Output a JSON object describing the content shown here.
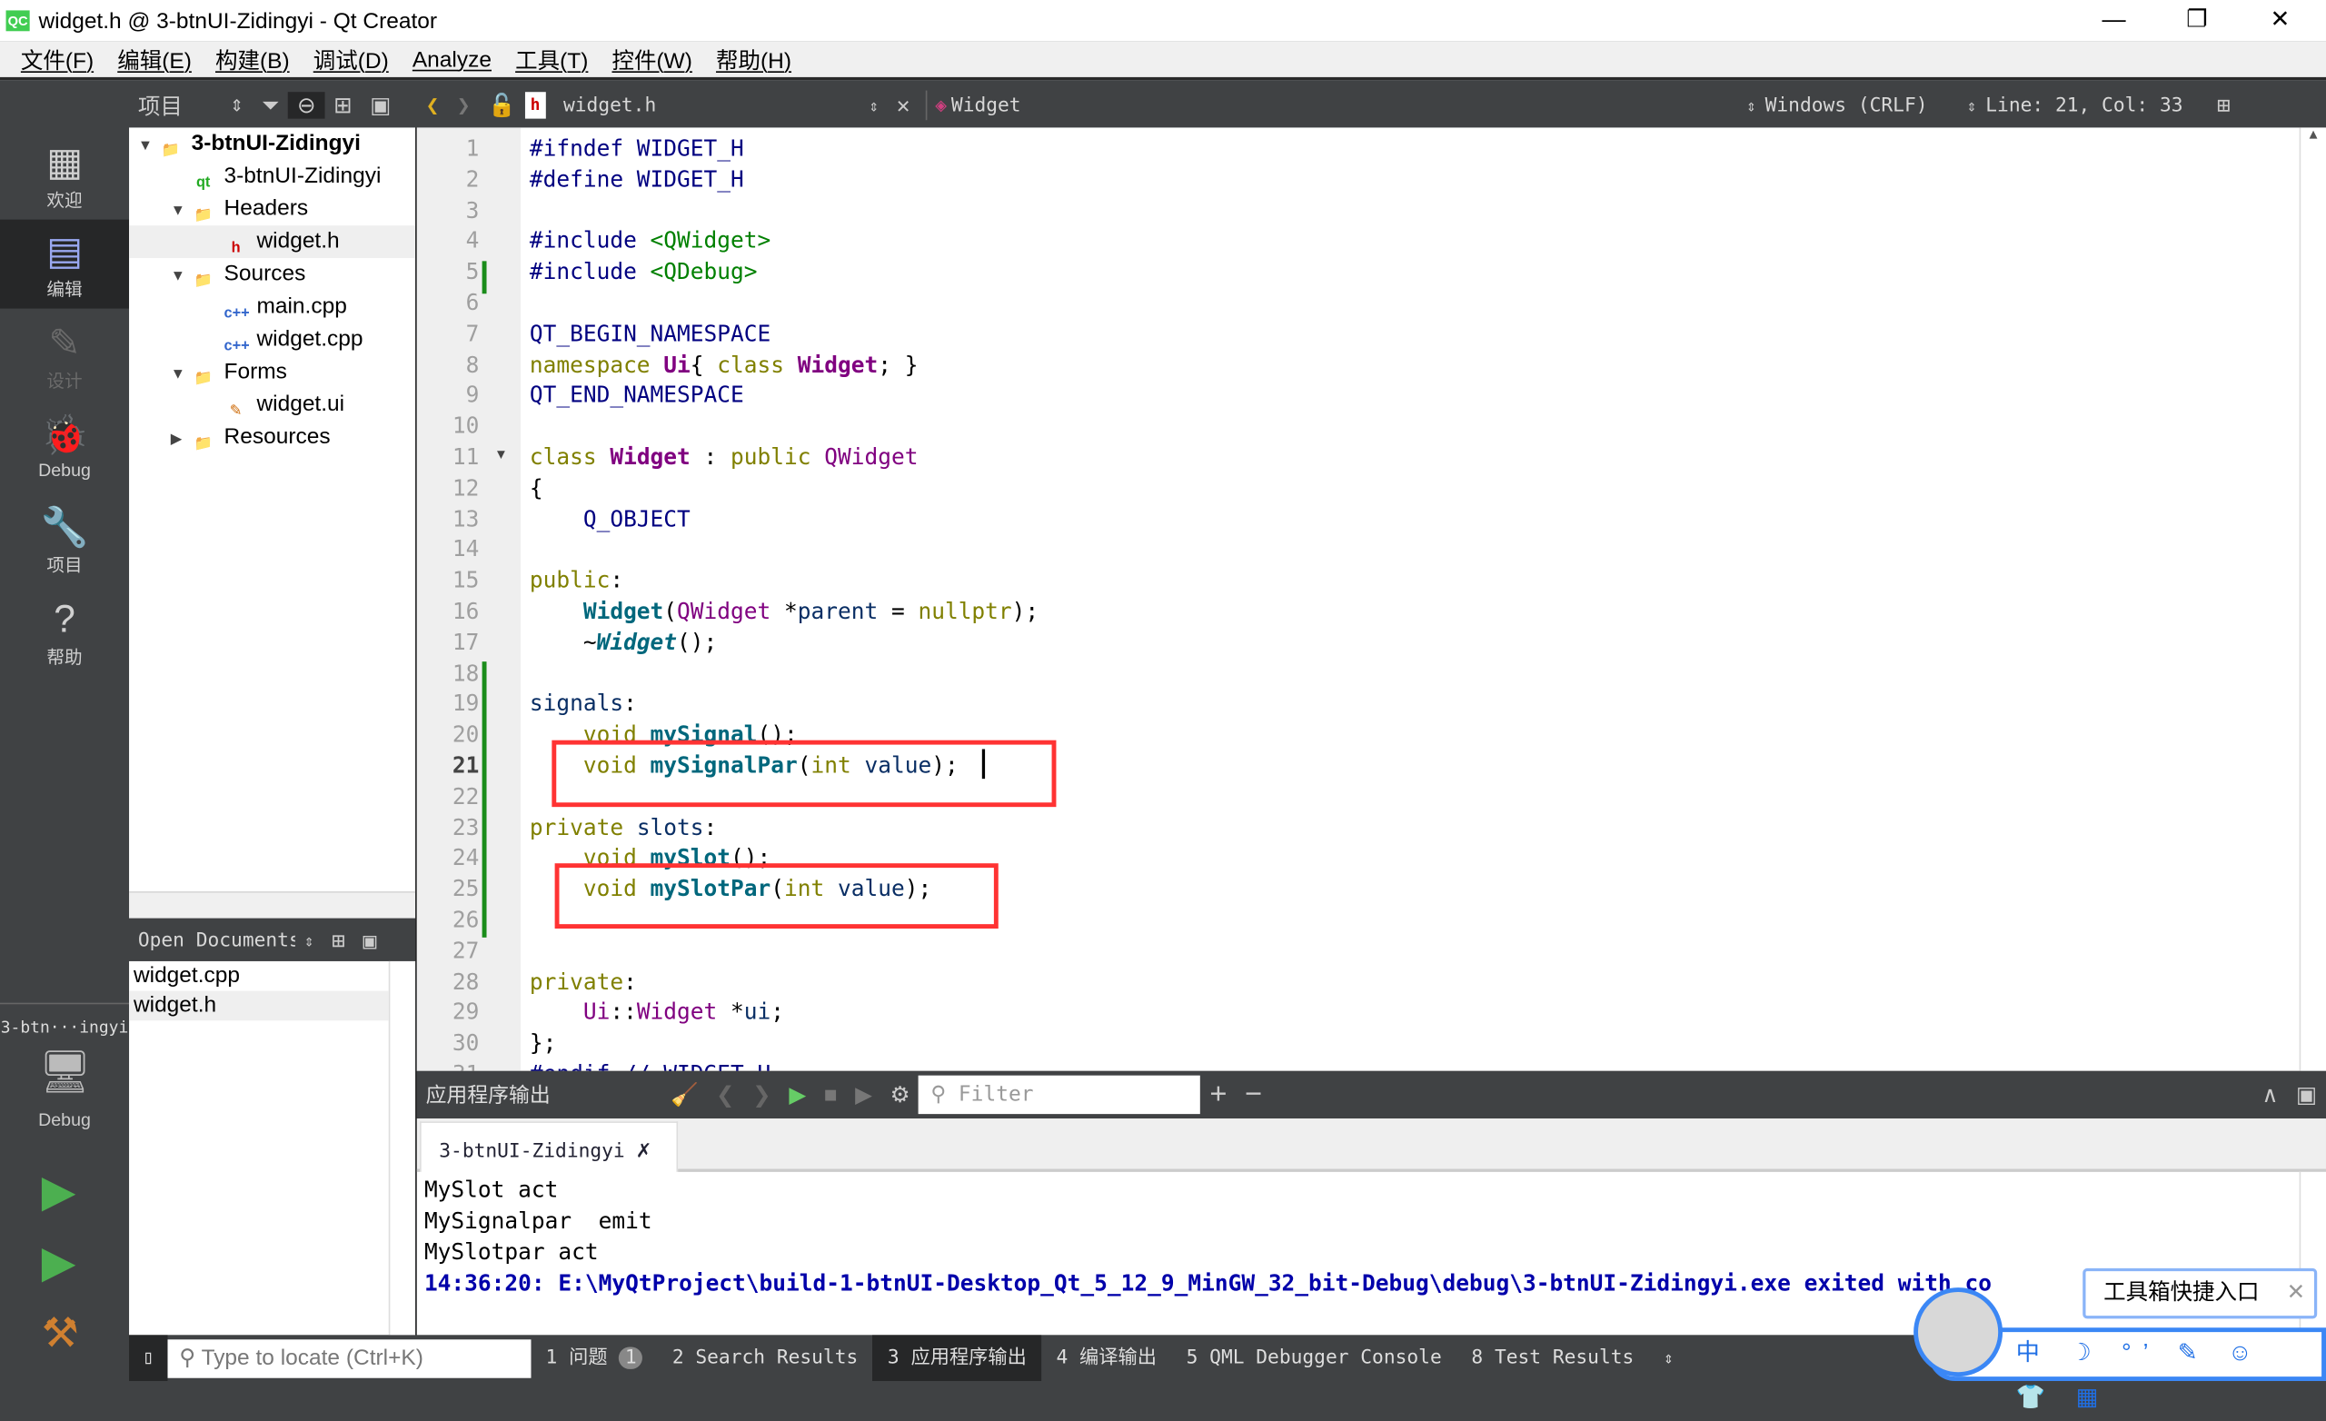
{
  "window": {
    "title": "widget.h @ 3-btnUI-Zidingyi - Qt Creator",
    "logo": "QC"
  },
  "menu": [
    "文件(F)",
    "编辑(E)",
    "构建(B)",
    "调试(D)",
    "Analyze",
    "工具(T)",
    "控件(W)",
    "帮助(H)"
  ],
  "modes": [
    {
      "label": "欢迎",
      "icon": "grid-icon"
    },
    {
      "label": "编辑",
      "icon": "edit-icon",
      "active": true
    },
    {
      "label": "设计",
      "icon": "pencil-icon",
      "disabled": true
    },
    {
      "label": "Debug",
      "icon": "bug-icon"
    },
    {
      "label": "项目",
      "icon": "wrench-icon"
    },
    {
      "label": "帮助",
      "icon": "help-icon"
    }
  ],
  "kit": {
    "project": "3-btn···ingyi",
    "config": "Debug"
  },
  "project_toolbar": {
    "label": "项目"
  },
  "tree": [
    {
      "label": "3-btnUI-Zidingyi",
      "level": 0,
      "expanded": true,
      "bold": true,
      "icon": "qt-project-icon"
    },
    {
      "label": "3-btnUI-Zidingyi",
      "level": 1,
      "icon": "qt-pro-file-icon"
    },
    {
      "label": "Headers",
      "level": 1,
      "expanded": true,
      "icon": "headers-folder-icon"
    },
    {
      "label": "widget.h",
      "level": 2,
      "selected": true,
      "icon": "header-file-icon"
    },
    {
      "label": "Sources",
      "level": 1,
      "expanded": true,
      "icon": "sources-folder-icon"
    },
    {
      "label": "main.cpp",
      "level": 2,
      "icon": "cpp-file-icon"
    },
    {
      "label": "widget.cpp",
      "level": 2,
      "icon": "cpp-file-icon"
    },
    {
      "label": "Forms",
      "level": 1,
      "expanded": true,
      "icon": "forms-folder-icon"
    },
    {
      "label": "widget.ui",
      "level": 2,
      "icon": "ui-file-icon"
    },
    {
      "label": "Resources",
      "level": 1,
      "expanded": false,
      "icon": "resources-folder-icon"
    }
  ],
  "open_documents": {
    "title": "Open Documents",
    "items": [
      "widget.cpp",
      "widget.h"
    ],
    "selected": "widget.h"
  },
  "editor_toolbar": {
    "file": "widget.h",
    "symbol": "Widget",
    "line_endings": "Windows (CRLF)",
    "position": "Line: 21, Col: 33"
  },
  "code": [
    [
      [
        "pp",
        "#ifndef WIDGET_H"
      ]
    ],
    [
      [
        "pp",
        "#define WIDGET_H"
      ]
    ],
    [],
    [
      [
        "pp",
        "#include "
      ],
      [
        "str",
        "<QWidget>"
      ]
    ],
    [
      [
        "pp",
        "#include "
      ],
      [
        "str",
        "<QDebug>"
      ]
    ],
    [],
    [
      [
        "pp",
        "QT_BEGIN_NAMESPACE"
      ]
    ],
    [
      [
        "kw",
        "namespace "
      ],
      [
        "tyb",
        "Ui"
      ],
      [
        "",
        "{ "
      ],
      [
        "kw",
        "class "
      ],
      [
        "tyb",
        "Widget"
      ],
      [
        "",
        "; }"
      ]
    ],
    [
      [
        "pp",
        "QT_END_NAMESPACE"
      ]
    ],
    [],
    [
      [
        "kw",
        "class "
      ],
      [
        "tyb",
        "Widget"
      ],
      [
        "",
        " : "
      ],
      [
        "kw",
        "public "
      ],
      [
        "ty",
        "QWidget"
      ]
    ],
    [
      [
        "",
        "{"
      ]
    ],
    [
      [
        "pp",
        "    Q_OBJECT"
      ]
    ],
    [],
    [
      [
        "kw",
        "public"
      ],
      [
        "",
        ":"
      ]
    ],
    [
      [
        "",
        "    "
      ],
      [
        "fn",
        "Widget"
      ],
      [
        "",
        "("
      ],
      [
        "ty",
        "QWidget"
      ],
      [
        "",
        " *"
      ],
      [
        "nv",
        "parent"
      ],
      [
        "",
        " = "
      ],
      [
        "kw",
        "nullptr"
      ],
      [
        "",
        ");"
      ]
    ],
    [
      [
        "",
        "    ~"
      ],
      [
        "fn it",
        "Widget"
      ],
      [
        "",
        "();"
      ]
    ],
    [],
    [
      [
        "nv",
        "signals"
      ],
      [
        "",
        ":"
      ]
    ],
    [
      [
        "",
        "    "
      ],
      [
        "kw",
        "void "
      ],
      [
        "fn",
        "mySignal"
      ],
      [
        "",
        "();"
      ]
    ],
    [
      [
        "",
        "    "
      ],
      [
        "kw",
        "void "
      ],
      [
        "fn",
        "mySignalPar"
      ],
      [
        "",
        "("
      ],
      [
        "kw",
        "int "
      ],
      [
        "nv",
        "value"
      ],
      [
        "",
        ");"
      ]
    ],
    [],
    [
      [
        "kw",
        "private "
      ],
      [
        "nv",
        "slots"
      ],
      [
        "",
        ":"
      ]
    ],
    [
      [
        "",
        "    "
      ],
      [
        "kw",
        "void "
      ],
      [
        "fn",
        "mySlot"
      ],
      [
        "",
        "();"
      ]
    ],
    [
      [
        "",
        "    "
      ],
      [
        "kw",
        "void "
      ],
      [
        "fn",
        "mySlotPar"
      ],
      [
        "",
        "("
      ],
      [
        "kw",
        "int "
      ],
      [
        "nv",
        "value"
      ],
      [
        "",
        ");"
      ]
    ],
    [],
    [],
    [
      [
        "kw",
        "private"
      ],
      [
        "",
        ":"
      ]
    ],
    [
      [
        "",
        "    "
      ],
      [
        "ty",
        "Ui"
      ],
      [
        "",
        "::"
      ],
      [
        "ty",
        "Widget"
      ],
      [
        "",
        " *"
      ],
      [
        "nv",
        "ui"
      ],
      [
        "",
        ";"
      ]
    ],
    [
      [
        "",
        "};"
      ]
    ],
    [
      [
        "pp",
        "#endif // WIDGET_H"
      ]
    ]
  ],
  "current_line": 21,
  "output": {
    "title": "应用程序输出",
    "filter_placeholder": "Filter",
    "tab": "3-btnUI-Zidingyi",
    "lines": [
      "MySlot act",
      "MySignalpar  emit",
      "MySlotpar act"
    ],
    "exit_line": "14:36:20: E:\\MyQtProject\\build-1-btnUI-Desktop_Qt_5_12_9_MinGW_32_bit-Debug\\debug\\3-btnUI-Zidingyi.exe exited with co"
  },
  "statusbar": {
    "locate_placeholder": "Type to locate (Ctrl+K)",
    "tabs": [
      "1 问题",
      "2 Search Results",
      "3 应用程序输出",
      "4 编译输出",
      "5 QML Debugger Console",
      "8 Test Results"
    ],
    "issues_count": "1",
    "active": "3 应用程序输出"
  },
  "overlay": {
    "popup": "工具箱快捷入口",
    "ime": "中 ☽ °’ ✎ ☺ 👕 ▦"
  },
  "colors": {
    "highlight_box": "#ff3333",
    "modebar": "#404244",
    "change_marker": "#1a8c1a"
  }
}
